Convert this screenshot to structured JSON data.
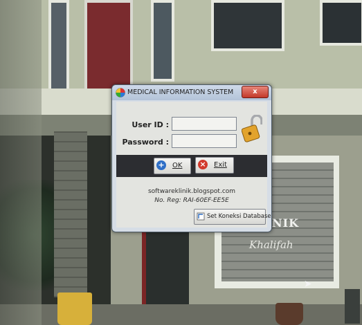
{
  "dialog": {
    "title": "MEDICAL INFORMATION SYSTEM",
    "close_label": "x",
    "userid_label": "User ID :",
    "password_label": "Password :",
    "userid_value": "",
    "password_value": "",
    "ok_label": "OK",
    "exit_label": "Exit",
    "website": "softwareklinik.blogspot.com",
    "reg_number": "No. Reg: RAI-60EF-EE5E",
    "db_button_label": "Set Koneksi Database"
  },
  "background": {
    "sign_word1": "NIK",
    "sign_word2": "Khalifah"
  },
  "colors": {
    "close_button": "#c2382a",
    "ok_icon": "#2f6fc7",
    "exit_icon": "#d23a2d",
    "lock": "#e2a32c"
  },
  "icons": {
    "app": "medical-logo-icon",
    "lock": "open-padlock-icon",
    "ok": "info-plus-icon",
    "exit": "cancel-x-icon",
    "database": "database-connection-icon"
  }
}
